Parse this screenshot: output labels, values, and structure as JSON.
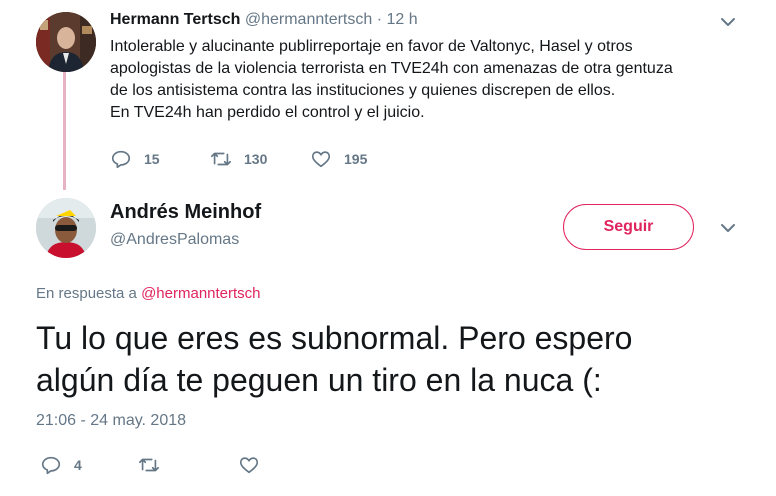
{
  "colors": {
    "accent": "#e0245e",
    "secondary_text": "#657786",
    "primary_text": "#14171a",
    "thread_line": "#e6b3c2"
  },
  "original_tweet": {
    "avatar_icon": "profile-photo",
    "display_name": "Hermann Tertsch",
    "handle": "@hermanntertsch",
    "separator": "·",
    "time": "12 h",
    "text_lines": [
      "Intolerable y alucinante publirreportaje en favor de Valtonyc, Hasel y otros",
      "apologistas de la violencia terrorista en TVE24h con amenazas de otra gentuza",
      "de los antisistema contra las instituciones y quienes discrepen de ellos.",
      "En TVE24h han perdido el control y el juicio."
    ],
    "actions": {
      "replies": "15",
      "retweets": "130",
      "likes": "195"
    }
  },
  "reply_tweet": {
    "avatar_icon": "profile-photo",
    "display_name": "Andrés Meinhof",
    "handle": "@AndresPalomas",
    "follow_label": "Seguir",
    "reply_to_prefix": "En respuesta a",
    "reply_to_handle": "@hermanntertsch",
    "text_lines": [
      "Tu lo que eres es subnormal. Pero espero",
      "algún día te peguen un tiro en la nuca (:"
    ],
    "date": "21:06 - 24 may. 2018",
    "actions": {
      "replies": "4"
    }
  }
}
